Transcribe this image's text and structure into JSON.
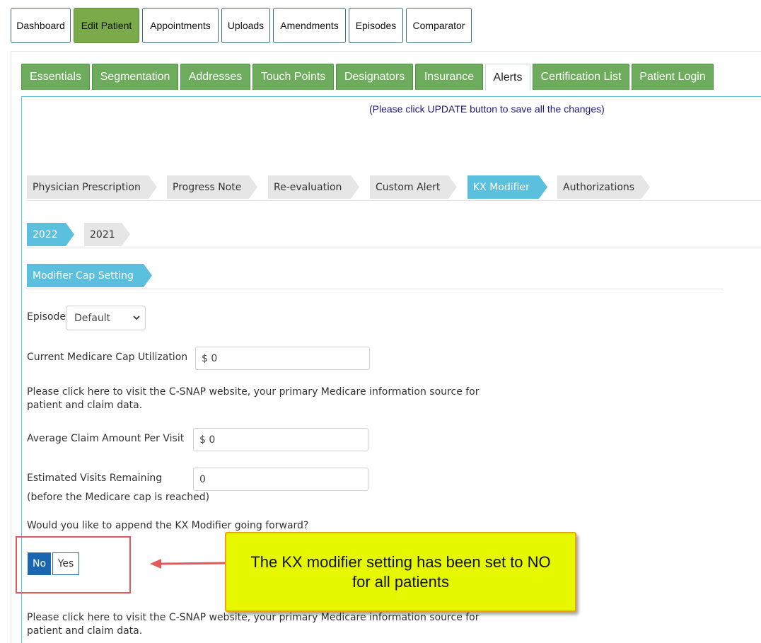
{
  "topnav": [
    "Dashboard",
    "Edit Patient",
    "Appointments",
    "Uploads",
    "Amendments",
    "Episodes",
    "Comparator"
  ],
  "topnav_active": "Edit Patient",
  "tabs": [
    "Essentials",
    "Segmentation",
    "Addresses",
    "Touch Points",
    "Designators",
    "Insurance",
    "Alerts",
    "Certification List",
    "Patient Login"
  ],
  "tabs_active": "Alerts",
  "notice": "(Please click UPDATE button to save all the changes)",
  "alert_tabs": [
    "Physician Prescription",
    "Progress Note",
    "Re-evaluation",
    "Custom Alert",
    "KX Modifier",
    "Authorizations"
  ],
  "alert_tabs_active": "KX Modifier",
  "years": [
    "2022",
    "2021"
  ],
  "years_active": "2022",
  "section_title": "Modifier Cap Setting",
  "form": {
    "episode_label": "Episode",
    "episode_value": "Default",
    "cap_label": "Current Medicare Cap Utilization",
    "cap_value": "$ 0",
    "csnap_text": "Please click here to visit the C-SNAP website, your primary Medicare information source for patient and claim data.",
    "avg_label": "Average Claim Amount Per Visit",
    "avg_value": "$ 0",
    "visits_label": "Estimated Visits Remaining",
    "visits_sub": "(before the Medicare cap is reached)",
    "visits_value": "0",
    "kx_question": "Would you like to append the KX Modifier going forward?",
    "kx_no": "No",
    "kx_yes": "Yes",
    "kx_selected": "No",
    "csnap_text_2": "Please click here to visit the C-SNAP website, your primary Medicare information source for patient and claim data."
  },
  "callout": "The KX modifier setting has been set to NO for all patients",
  "colors": {
    "green_tab": "#6cac5c",
    "active_nav": "#7aaa4a",
    "arrow_active": "#5bc0de",
    "toggle_on": "#1a66b0",
    "callout_bg": "#e6f800",
    "annotation_red": "#e35858"
  }
}
